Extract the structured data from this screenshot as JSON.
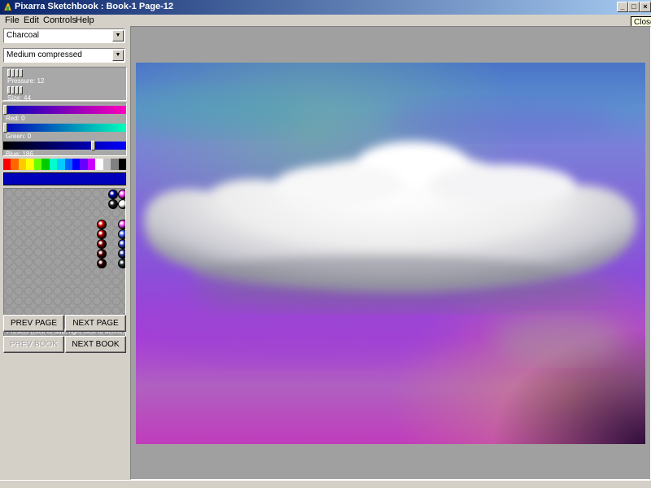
{
  "window": {
    "title": "Pixarra Sketchbook : Book-1 Page-12",
    "close_tooltip": "Close"
  },
  "menu": [
    "File",
    "Edit",
    "Controls",
    "Help"
  ],
  "tools": {
    "brush_selected": "Charcoal",
    "mode_selected": "Medium compressed"
  },
  "controls": {
    "pressure_label": "Pressure: 12",
    "size_label": "Size: 44",
    "red_label": "Red: 0",
    "green_label": "Green: 0",
    "blue_label": "Blue: 186"
  },
  "colors": {
    "current": "#0000ba",
    "palette": [
      "#ff0000",
      "#ff6600",
      "#ffcc00",
      "#ffff00",
      "#66ff00",
      "#00cc00",
      "#00ffcc",
      "#00ccff",
      "#0066ff",
      "#0000ff",
      "#6600ff",
      "#cc00ff",
      "#ffffff",
      "#c0c0c0",
      "#808080",
      "#000000"
    ]
  },
  "presets": {
    "label": "Presets (click to add, right click to delete)"
  },
  "navigation": {
    "prev_page": "PREV PAGE",
    "next_page": "NEXT PAGE",
    "prev_book": "PREV BOOK",
    "next_book": "NEXT BOOK"
  }
}
